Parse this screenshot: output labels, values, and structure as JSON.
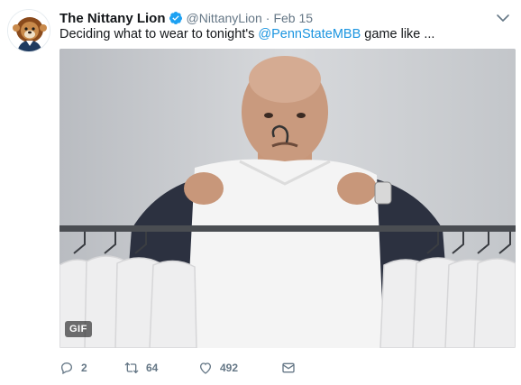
{
  "tweet": {
    "display_name": "The Nittany Lion",
    "handle": "@NittanyLion",
    "separator": "·",
    "time": "Feb 15",
    "text_before": "Deciding what to wear to tonight's ",
    "mention": "@PennStateMBB",
    "text_after": " game like ...",
    "media_badge": "GIF"
  },
  "actions": {
    "reply_count": "2",
    "retweet_count": "64",
    "like_count": "492"
  },
  "colors": {
    "link": "#1b95e0",
    "muted": "#657786",
    "verified": "#1da1f2"
  },
  "icons": {
    "verified": "verified-badge-icon",
    "more": "chevron-down-icon",
    "reply": "reply-icon",
    "retweet": "retweet-icon",
    "like": "heart-icon",
    "dm": "envelope-icon"
  }
}
